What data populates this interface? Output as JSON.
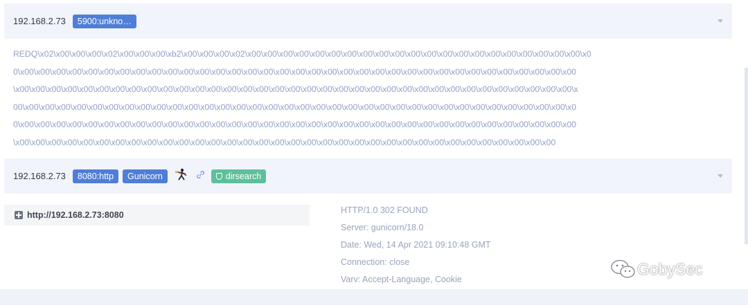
{
  "rows": [
    {
      "ip": "192.168.2.73",
      "port_tag": "5900:unkno…",
      "banner_lines": [
        "REDQ\\x02\\x00\\x00\\x00\\x02\\x00\\x00\\x00\\xb2\\x00\\x00\\x00\\x02\\x00\\x00\\x00\\x00\\x00\\x00\\x00\\x00\\x00\\x00\\x00\\x00\\x00\\x00\\x00\\x00\\x00\\x00\\x00\\x00\\x00\\x0",
        "0\\x00\\x00\\x00\\x00\\x00\\x00\\x00\\x00\\x00\\x00\\x00\\x00\\x00\\x00\\x00\\x00\\x00\\x00\\x00\\x00\\x00\\x00\\x00\\x00\\x00\\x00\\x00\\x00\\x00\\x00\\x00\\x00\\x00\\x00\\x00",
        "\\x00\\x00\\x00\\x00\\x00\\x00\\x00\\x00\\x00\\x00\\x00\\x00\\x00\\x00\\x00\\x00\\x00\\x00\\x00\\x00\\x00\\x00\\x00\\x00\\x00\\x00\\x00\\x00\\x00\\x00\\x00\\x00\\x00\\x00\\x00\\x",
        "00\\x00\\x00\\x00\\x00\\x00\\x00\\x00\\x00\\x00\\x00\\x00\\x00\\x00\\x00\\x00\\x00\\x00\\x00\\x00\\x00\\x00\\x00\\x00\\x00\\x00\\x00\\x00\\x00\\x00\\x00\\x00\\x00\\x00\\x00\\x0",
        "0\\x00\\x00\\x00\\x00\\x00\\x00\\x00\\x00\\x00\\x00\\x00\\x00\\x00\\x00\\x00\\x00\\x00\\x00\\x00\\x00\\x00\\x00\\x00\\x00\\x00\\x00\\x00\\x00\\x00\\x00\\x00\\x00\\x00\\x00\\x00",
        "\\x00\\x00\\x00\\x00\\x00\\x00\\x00\\x00\\x00\\x00\\x00\\x00\\x00\\x00\\x00\\x00\\x00\\x00\\x00\\x00\\x00\\x00\\x00\\x00\\x00\\x00\\x00\\x00\\x00\\x00\\x00\\x00\\x00\\x00"
      ]
    },
    {
      "ip": "192.168.2.73",
      "port_tag": "8080:http",
      "product_tag": "Gunicorn",
      "tool_icon": "exploit-character-icon",
      "link_icon": "link-icon",
      "dirsearch_label": "dirsearch",
      "url": "http://192.168.2.73:8080",
      "http_lines": [
        "HTTP/1.0 302 FOUND",
        "Server: gunicorn/18.0",
        "Date: Wed, 14 Apr 2021 09:10:48 GMT",
        "Connection: close",
        "Varv: Accept-Language, Cookie"
      ]
    }
  ],
  "watermark": "GobySec",
  "colors": {
    "tag_blue": "#4f7ed6",
    "tag_green": "#5fbf9a",
    "header_bg": "#f1f4fa",
    "banner_text": "#8fa0c4"
  }
}
